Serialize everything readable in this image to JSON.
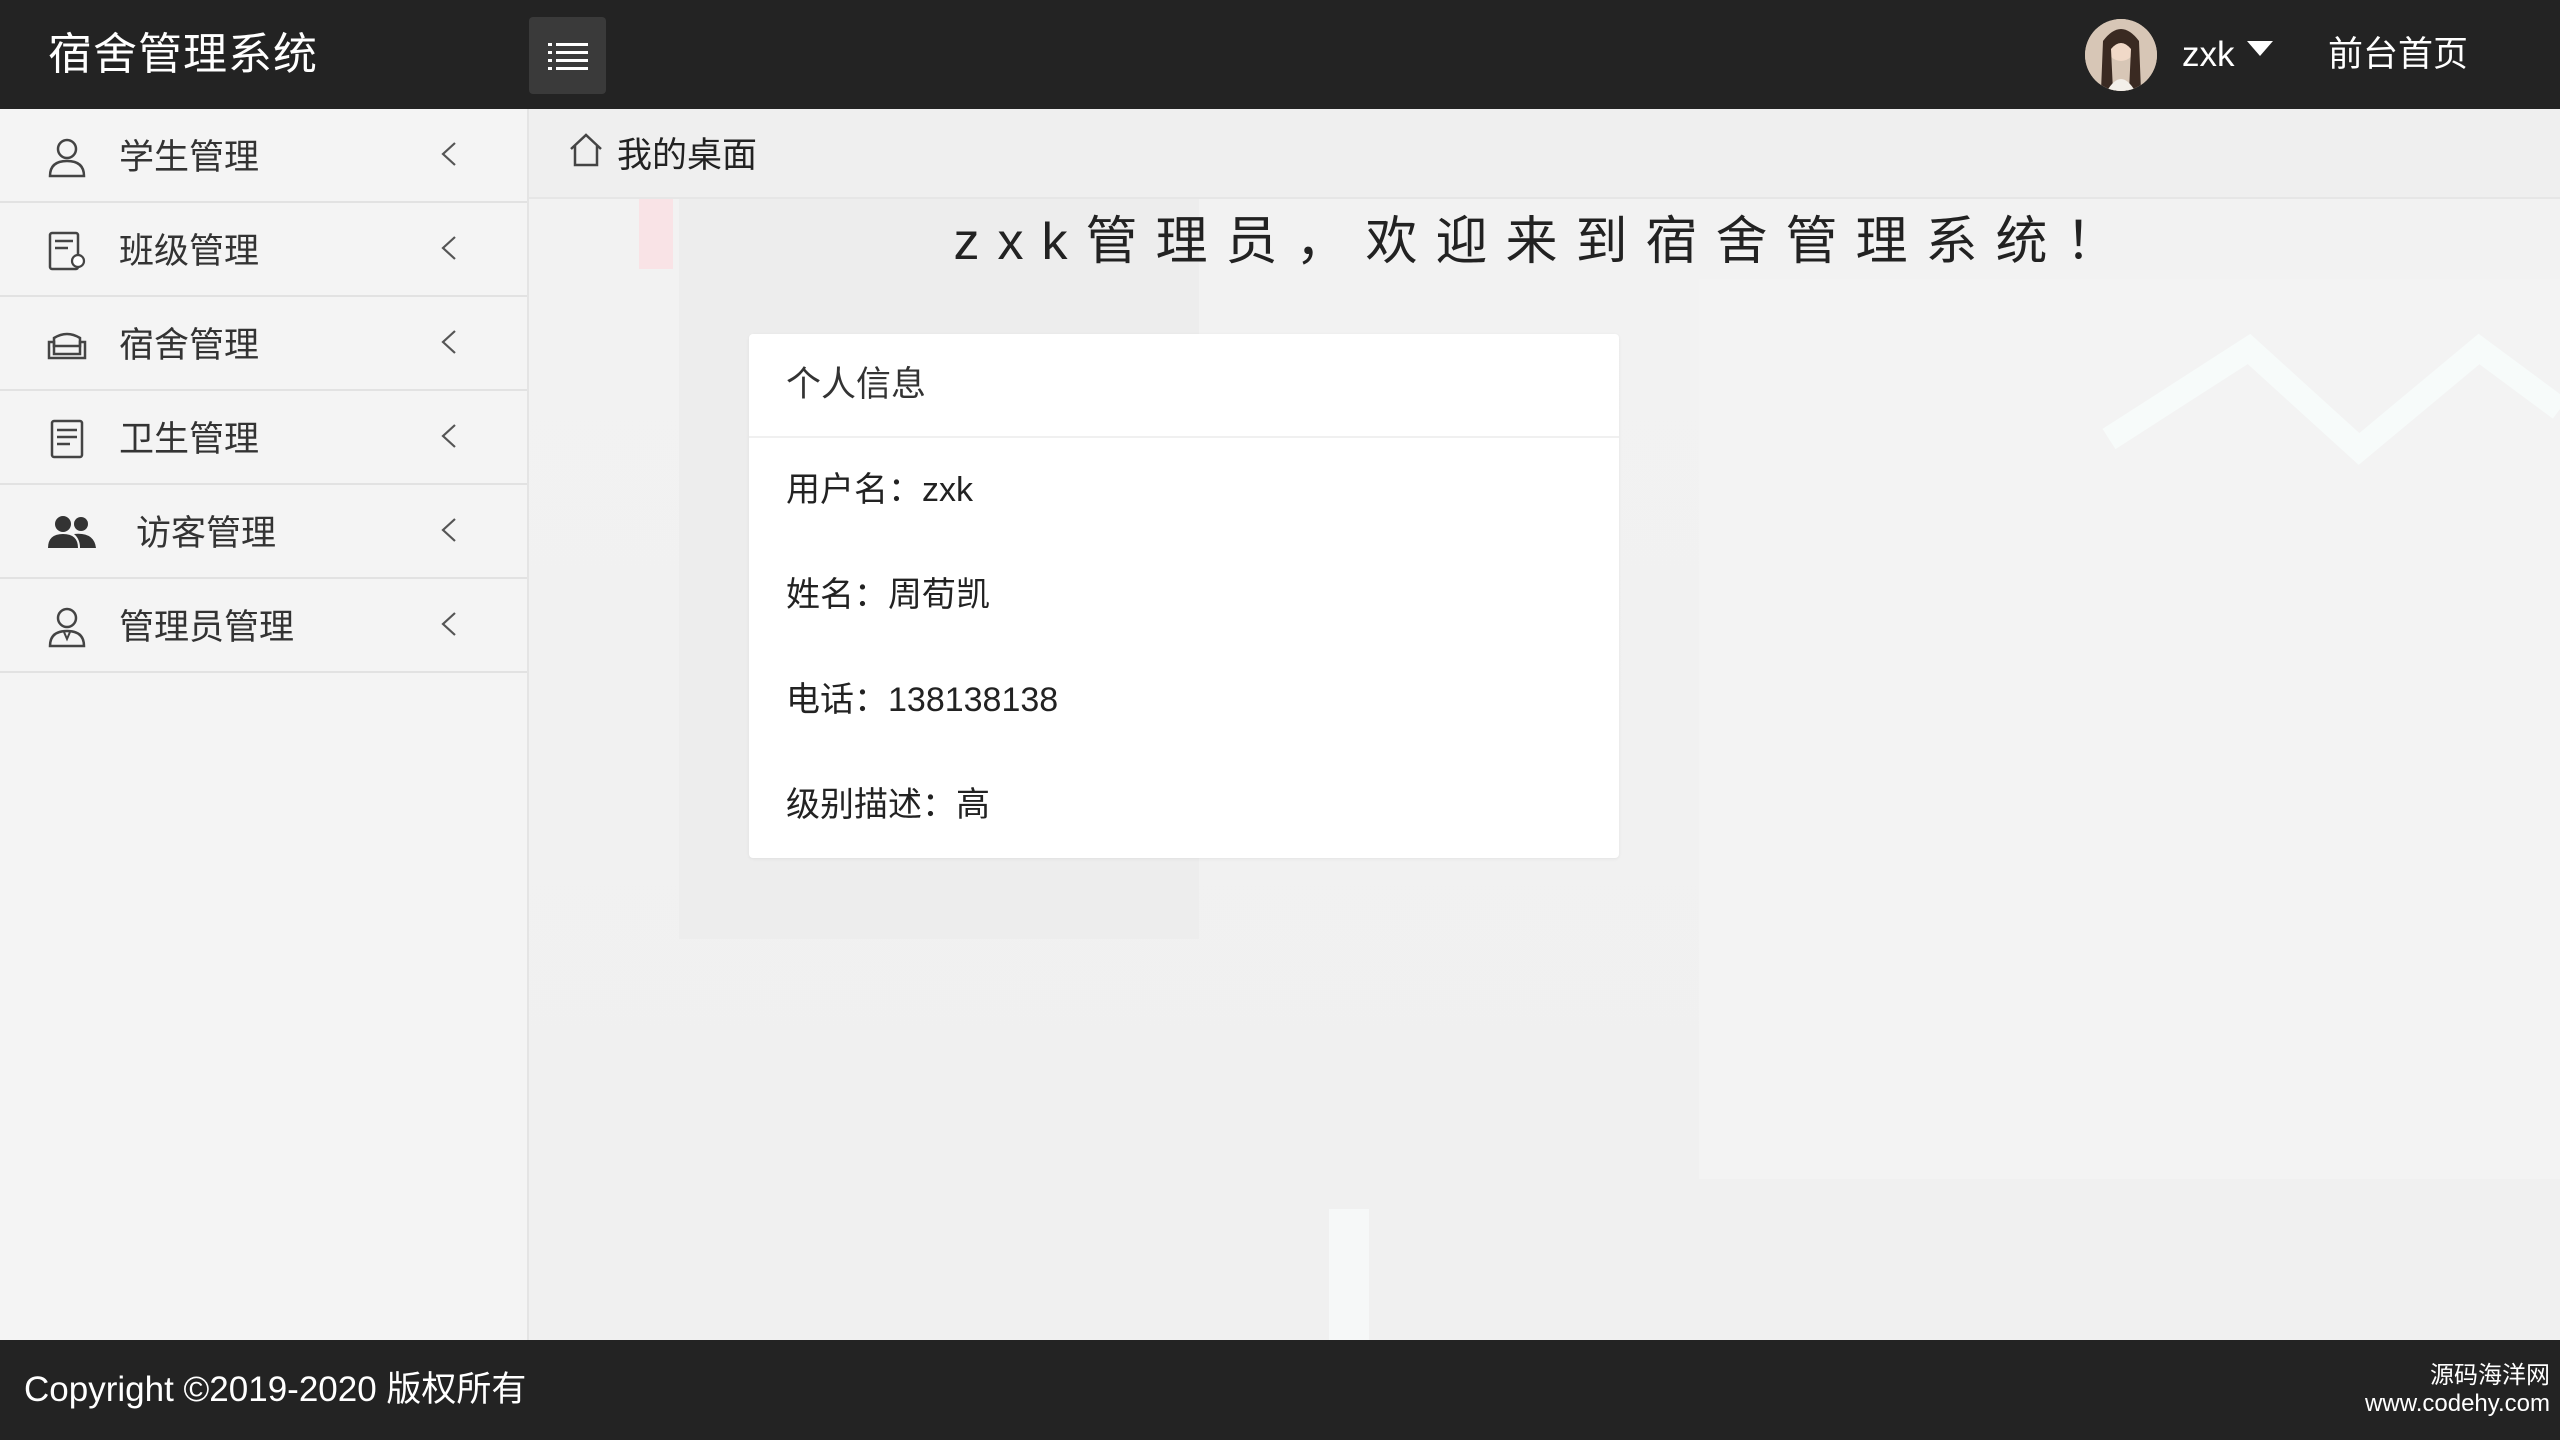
{
  "header": {
    "brand": "宿舍管理系统",
    "username": "zxk",
    "front_link": "前台首页"
  },
  "sidebar": {
    "items": [
      {
        "label": "学生管理",
        "icon": "user-icon"
      },
      {
        "label": "班级管理",
        "icon": "class-icon"
      },
      {
        "label": "宿舍管理",
        "icon": "sofa-icon"
      },
      {
        "label": "卫生管理",
        "icon": "document-icon"
      },
      {
        "label": "访客管理",
        "icon": "users-icon"
      },
      {
        "label": "管理员管理",
        "icon": "admin-icon"
      }
    ]
  },
  "main": {
    "breadcrumb": "我的桌面",
    "welcome": "zxk管理员，欢迎来到宿舍管理系统！",
    "card": {
      "title": "个人信息",
      "rows": [
        "用户名：zxk",
        "姓名：周荀凯",
        "电话：138138138",
        "级别描述：高"
      ]
    }
  },
  "footer": {
    "copyright": "Copyright ©2019-2020 版权所有",
    "watermark_line1": "源码海洋网",
    "watermark_line2": "www.codehy.com"
  },
  "colors": {
    "topbar": "#232323",
    "sidebar": "#f4f4f4",
    "main_bg": "#f0f0f0",
    "card": "#ffffff"
  }
}
